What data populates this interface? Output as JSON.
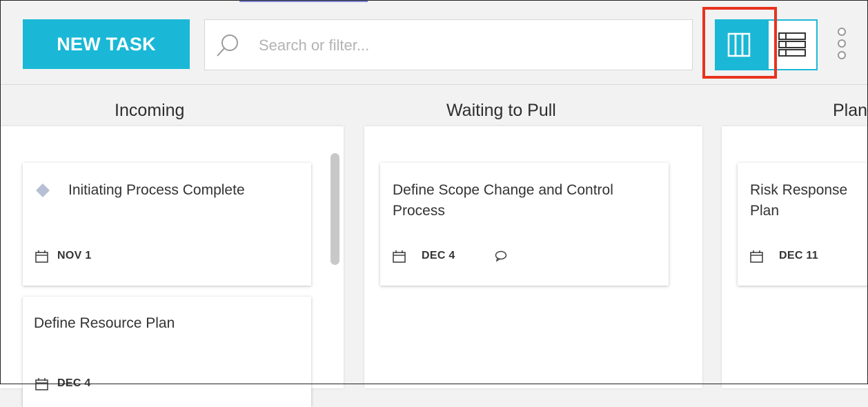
{
  "toolbar": {
    "new_task_label": "NEW TASK",
    "search_placeholder": "Search or filter...",
    "view_board_icon": "board-view-icon",
    "view_list_icon": "list-view-icon",
    "more_icon": "vertical-ellipsis-icon"
  },
  "colors": {
    "accent": "#1ab8d6",
    "highlight": "#e8321e"
  },
  "columns": [
    {
      "title": "Incoming",
      "cards": [
        {
          "title": "Initiating Process Complete",
          "milestone_icon": "diamond-icon",
          "date": "NOV 1"
        },
        {
          "title": "Define Resource Plan",
          "date": "DEC 4"
        }
      ]
    },
    {
      "title": "Waiting to Pull",
      "cards": [
        {
          "title": "Define Scope Change and Control Process",
          "date": "DEC 4",
          "comment_icon": "comment-icon"
        }
      ]
    },
    {
      "title": "Planning",
      "cards": [
        {
          "title": "Risk Response Plan",
          "date": "DEC 11"
        }
      ]
    }
  ]
}
